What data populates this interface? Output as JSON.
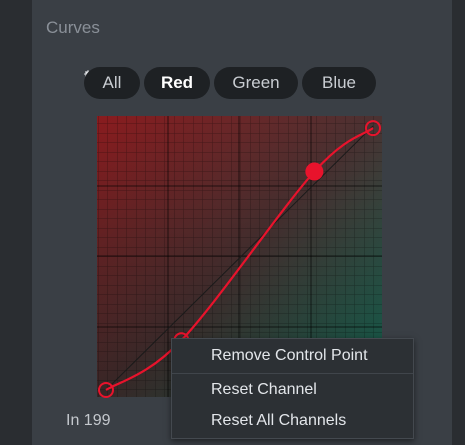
{
  "panel": {
    "title": "Curves"
  },
  "tools": {
    "eyedropper_icon": "eyedropper-sparkle-icon"
  },
  "channels": {
    "items": [
      {
        "label": "All",
        "active": false
      },
      {
        "label": "Red",
        "active": true
      },
      {
        "label": "Green",
        "active": false
      },
      {
        "label": "Blue",
        "active": false
      }
    ]
  },
  "curve": {
    "channel": "Red",
    "color": "#e8132c",
    "control_points": [
      {
        "in": 0,
        "out": 0
      },
      {
        "in": 72,
        "out": 48
      },
      {
        "in": 199,
        "out": 211
      },
      {
        "in": 255,
        "out": 253
      }
    ],
    "selected_index": 2
  },
  "readout": {
    "text": "In 199"
  },
  "context_menu": {
    "items": [
      {
        "label": "Remove Control Point"
      },
      {
        "label": "Reset Channel"
      },
      {
        "label": "Reset All Channels"
      }
    ]
  }
}
